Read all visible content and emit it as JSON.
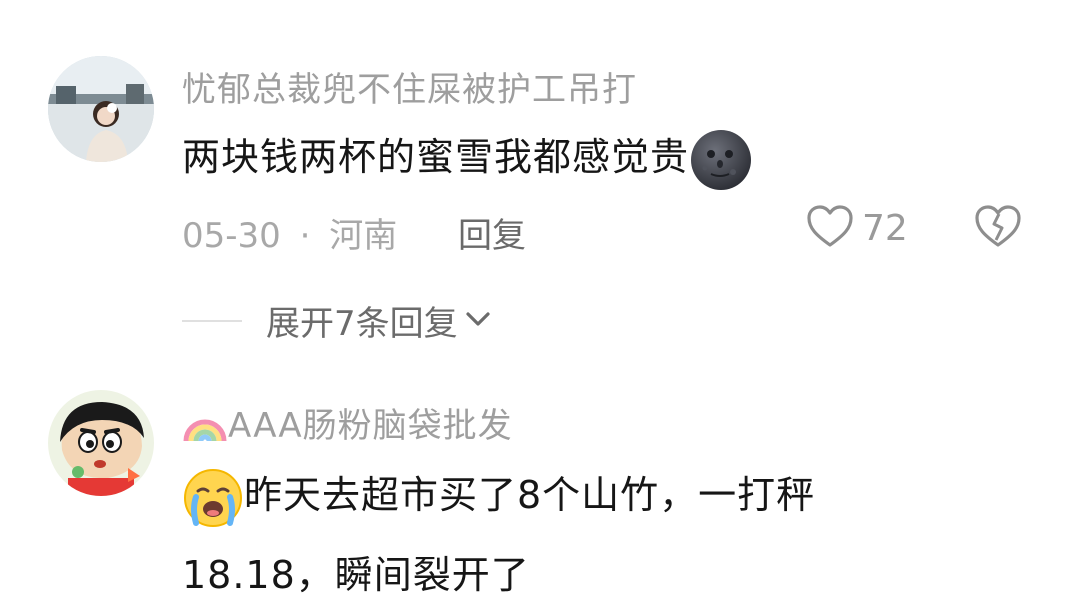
{
  "comments": [
    {
      "username": "忧郁总裁兜不住屎被护工吊打",
      "content": "两块钱两杯的蜜雪我都感觉贵",
      "emoji": "new-moon-face-emoji",
      "date": "05-30",
      "separator": "·",
      "location": "河南",
      "reply_label": "回复",
      "likes": "72",
      "expand_label": "展开7条回复"
    },
    {
      "username_badge": "rainbow-emoji",
      "username": "AAA肠粉脑袋批发",
      "leading_emoji": "crying-face-emoji",
      "content_line1": "昨天去超市买了8个山竹，一打秤",
      "content_line2": "18.18，瞬间裂开了"
    }
  ],
  "colors": {
    "username": "#9e9e9e",
    "content": "#161616",
    "meta": "#a8a8a8",
    "reply": "#6a6a6a",
    "icon": "#8e8e8e"
  }
}
